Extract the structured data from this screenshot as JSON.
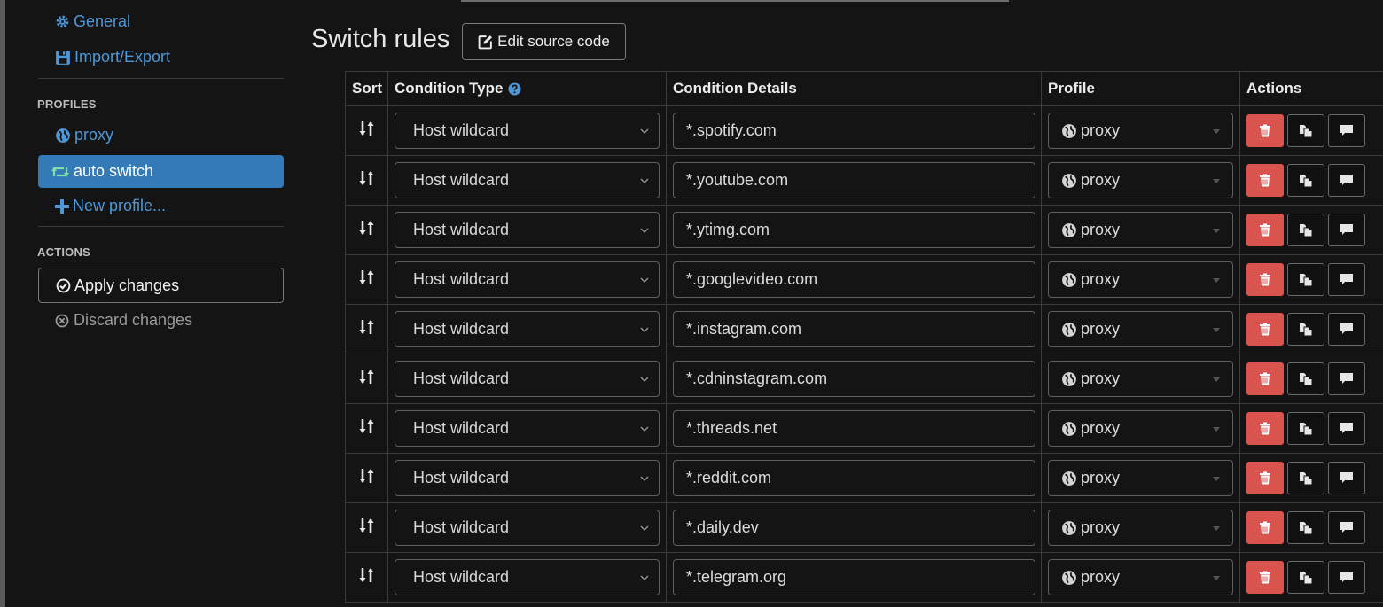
{
  "sidebar": {
    "settings": [
      {
        "label": "General",
        "icon": "gear-icon"
      },
      {
        "label": "Import/Export",
        "icon": "floppy-icon"
      }
    ],
    "profiles_title": "PROFILES",
    "profiles": [
      {
        "label": "proxy",
        "icon": "globe-icon"
      },
      {
        "label": "auto switch",
        "icon": "retweet-icon",
        "active": true
      }
    ],
    "new_profile": "New profile...",
    "actions_title": "ACTIONS",
    "apply": "Apply changes",
    "discard": "Discard changes"
  },
  "header": {
    "title": "Switch rules",
    "edit_source": "Edit source code"
  },
  "table": {
    "columns": [
      "Sort",
      "Condition Type",
      "Condition Details",
      "Profile",
      "Actions"
    ],
    "rows": [
      {
        "type": "Host wildcard",
        "details": "*.spotify.com",
        "profile": "proxy"
      },
      {
        "type": "Host wildcard",
        "details": "*.youtube.com",
        "profile": "proxy"
      },
      {
        "type": "Host wildcard",
        "details": "*.ytimg.com",
        "profile": "proxy"
      },
      {
        "type": "Host wildcard",
        "details": "*.googlevideo.com",
        "profile": "proxy"
      },
      {
        "type": "Host wildcard",
        "details": "*.instagram.com",
        "profile": "proxy"
      },
      {
        "type": "Host wildcard",
        "details": "*.cdninstagram.com",
        "profile": "proxy"
      },
      {
        "type": "Host wildcard",
        "details": "*.threads.net",
        "profile": "proxy"
      },
      {
        "type": "Host wildcard",
        "details": "*.reddit.com",
        "profile": "proxy"
      },
      {
        "type": "Host wildcard",
        "details": "*.daily.dev",
        "profile": "proxy"
      },
      {
        "type": "Host wildcard",
        "details": "*.telegram.org",
        "profile": "proxy"
      }
    ]
  },
  "colors": {
    "accent": "#337ab7",
    "link": "#4f98d8",
    "danger": "#d9534f",
    "background": "#141414"
  }
}
